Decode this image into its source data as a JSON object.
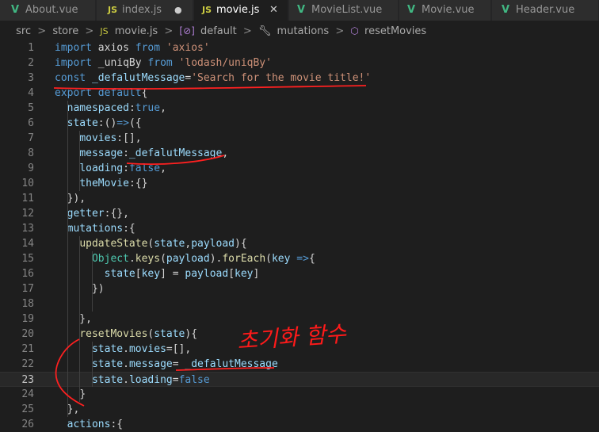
{
  "tabs": [
    {
      "icon": "vue-icon",
      "label": "About.vue",
      "active": false,
      "modified": false
    },
    {
      "icon": "js-icon",
      "label": "index.js",
      "active": false,
      "modified": true
    },
    {
      "icon": "js-icon",
      "label": "movie.js",
      "active": true,
      "modified": false
    },
    {
      "icon": "vue-icon",
      "label": "MovieList.vue",
      "active": false,
      "modified": false
    },
    {
      "icon": "vue-icon",
      "label": "Movie.vue",
      "active": false,
      "modified": false
    },
    {
      "icon": "vue-icon",
      "label": "Header.vue",
      "active": false,
      "modified": false
    }
  ],
  "tab_glyphs": {
    "js": "JS",
    "vue": "V",
    "close": "✕",
    "modified": "●"
  },
  "breadcrumb": [
    "src",
    "store",
    "movie.js",
    "default",
    "mutations",
    "resetMovies"
  ],
  "breadcrumb_separator": ">",
  "editor": {
    "current_line": 23,
    "lines": [
      {
        "n": "1",
        "tokens": [
          [
            "kw",
            "import"
          ],
          [
            "pn",
            " axios "
          ],
          [
            "kw",
            "from"
          ],
          [
            "pn",
            " "
          ],
          [
            "str",
            "'axios'"
          ]
        ]
      },
      {
        "n": "2",
        "tokens": [
          [
            "kw",
            "import"
          ],
          [
            "pn",
            " _uniqBy "
          ],
          [
            "kw",
            "from"
          ],
          [
            "pn",
            " "
          ],
          [
            "str",
            "'lodash/uniqBy'"
          ]
        ]
      },
      {
        "n": "3",
        "tokens": [
          [
            "kw",
            "const"
          ],
          [
            "pn",
            " "
          ],
          [
            "prop",
            "_defalutMessage"
          ],
          [
            "pn",
            "="
          ],
          [
            "str",
            "'Search for the movie title!'"
          ]
        ]
      },
      {
        "n": "4",
        "tokens": [
          [
            "kw",
            "export"
          ],
          [
            "pn",
            " "
          ],
          [
            "kw",
            "default"
          ],
          [
            "pn",
            "{"
          ]
        ]
      },
      {
        "n": "5",
        "tokens": [
          [
            "pn",
            "  "
          ],
          [
            "prop",
            "namespaced"
          ],
          [
            "pn",
            ":"
          ],
          [
            "kw",
            "true"
          ],
          [
            "pn",
            ","
          ]
        ]
      },
      {
        "n": "6",
        "tokens": [
          [
            "pn",
            "  "
          ],
          [
            "prop",
            "state"
          ],
          [
            "pn",
            ":()"
          ],
          [
            "kw",
            "=>"
          ],
          [
            "pn",
            "({"
          ]
        ]
      },
      {
        "n": "7",
        "tokens": [
          [
            "pn",
            "    "
          ],
          [
            "prop",
            "movies"
          ],
          [
            "pn",
            ":[],"
          ]
        ]
      },
      {
        "n": "8",
        "tokens": [
          [
            "pn",
            "    "
          ],
          [
            "prop",
            "message"
          ],
          [
            "pn",
            ":"
          ],
          [
            "prop",
            "_defalutMessage"
          ],
          [
            "pn",
            ","
          ]
        ]
      },
      {
        "n": "9",
        "tokens": [
          [
            "pn",
            "    "
          ],
          [
            "prop",
            "loading"
          ],
          [
            "pn",
            ":"
          ],
          [
            "kw",
            "false"
          ],
          [
            "pn",
            ","
          ]
        ]
      },
      {
        "n": "10",
        "tokens": [
          [
            "pn",
            "    "
          ],
          [
            "prop",
            "theMovie"
          ],
          [
            "pn",
            ":{}"
          ]
        ]
      },
      {
        "n": "11",
        "tokens": [
          [
            "pn",
            "  }),"
          ]
        ]
      },
      {
        "n": "12",
        "tokens": [
          [
            "pn",
            "  "
          ],
          [
            "prop",
            "getter"
          ],
          [
            "pn",
            ":{},"
          ]
        ]
      },
      {
        "n": "13",
        "tokens": [
          [
            "pn",
            "  "
          ],
          [
            "prop",
            "mutations"
          ],
          [
            "pn",
            ":{"
          ]
        ]
      },
      {
        "n": "14",
        "tokens": [
          [
            "pn",
            "    "
          ],
          [
            "fn",
            "updateState"
          ],
          [
            "pn",
            "("
          ],
          [
            "prop",
            "state"
          ],
          [
            "pn",
            ","
          ],
          [
            "prop",
            "payload"
          ],
          [
            "pn",
            "){"
          ]
        ]
      },
      {
        "n": "15",
        "tokens": [
          [
            "pn",
            "      "
          ],
          [
            "cls",
            "Object"
          ],
          [
            "pn",
            "."
          ],
          [
            "fn",
            "keys"
          ],
          [
            "pn",
            "("
          ],
          [
            "prop",
            "payload"
          ],
          [
            "pn",
            ")."
          ],
          [
            "fn",
            "forEach"
          ],
          [
            "pn",
            "("
          ],
          [
            "prop",
            "key"
          ],
          [
            "pn",
            " "
          ],
          [
            "kw",
            "=>"
          ],
          [
            "pn",
            "{"
          ]
        ]
      },
      {
        "n": "16",
        "tokens": [
          [
            "pn",
            "        "
          ],
          [
            "prop",
            "state"
          ],
          [
            "pn",
            "["
          ],
          [
            "prop",
            "key"
          ],
          [
            "pn",
            "] = "
          ],
          [
            "prop",
            "payload"
          ],
          [
            "pn",
            "["
          ],
          [
            "prop",
            "key"
          ],
          [
            "pn",
            "]"
          ]
        ]
      },
      {
        "n": "17",
        "tokens": [
          [
            "pn",
            "      })"
          ]
        ]
      },
      {
        "n": "18",
        "tokens": []
      },
      {
        "n": "19",
        "tokens": [
          [
            "pn",
            "    },"
          ]
        ]
      },
      {
        "n": "20",
        "tokens": [
          [
            "pn",
            "    "
          ],
          [
            "fn",
            "resetMovies"
          ],
          [
            "pn",
            "("
          ],
          [
            "prop",
            "state"
          ],
          [
            "pn",
            ")"
          ],
          [
            "pn",
            "{"
          ]
        ]
      },
      {
        "n": "21",
        "tokens": [
          [
            "pn",
            "      "
          ],
          [
            "prop",
            "state"
          ],
          [
            "pn",
            "."
          ],
          [
            "prop",
            "movies"
          ],
          [
            "pn",
            "=[],"
          ]
        ]
      },
      {
        "n": "22",
        "tokens": [
          [
            "pn",
            "      "
          ],
          [
            "prop",
            "state"
          ],
          [
            "pn",
            "."
          ],
          [
            "prop",
            "message"
          ],
          [
            "pn",
            "= "
          ],
          [
            "prop",
            "_defalutMessage"
          ]
        ]
      },
      {
        "n": "23",
        "tokens": [
          [
            "pn",
            "      "
          ],
          [
            "prop",
            "state"
          ],
          [
            "pn",
            "."
          ],
          [
            "prop",
            "loading"
          ],
          [
            "pn",
            "="
          ],
          [
            "kw",
            "false"
          ]
        ]
      },
      {
        "n": "24",
        "tokens": [
          [
            "pn",
            "    "
          ],
          [
            "pn",
            "}"
          ]
        ]
      },
      {
        "n": "25",
        "tokens": [
          [
            "pn",
            "  },"
          ]
        ]
      },
      {
        "n": "26",
        "tokens": [
          [
            "pn",
            "  "
          ],
          [
            "prop",
            "actions"
          ],
          [
            "pn",
            ":{"
          ]
        ]
      }
    ]
  },
  "annotation": {
    "text": "초기화 함수",
    "color": "#ff1a1a"
  },
  "colors": {
    "keyword": "#569cd6",
    "string": "#ce9178",
    "property": "#9cdcfe",
    "function": "#dcdcaa",
    "class": "#4ec9b0",
    "text": "#d4d4d4",
    "vue": "#41b883",
    "js": "#cbcb41"
  }
}
